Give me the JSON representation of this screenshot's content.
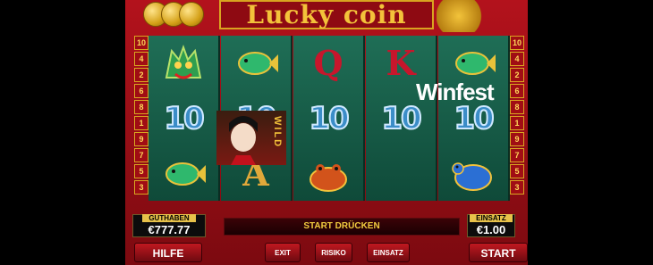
{
  "title": "Lucky coin",
  "watermark": "Winfest",
  "paylines": {
    "left": [
      "10",
      "4",
      "2",
      "6",
      "8",
      "1",
      "9",
      "7",
      "5",
      "3"
    ],
    "right": [
      "10",
      "4",
      "2",
      "6",
      "8",
      "1",
      "9",
      "7",
      "5",
      "3"
    ]
  },
  "reels": [
    [
      "dragon",
      "10",
      "fish"
    ],
    [
      "fish",
      "10",
      "A"
    ],
    [
      "Q",
      "10",
      "toad"
    ],
    [
      "K",
      "10",
      "wild"
    ],
    [
      "fish",
      "10",
      "turtle"
    ]
  ],
  "wild_label": "WILD",
  "balance": {
    "label": "GUTHABEN",
    "value": "€777.77"
  },
  "bet": {
    "label": "EINSATZ",
    "value": "€1.00"
  },
  "message": "START DRÜCKEN",
  "buttons": {
    "help": "HILFE",
    "exit": "EXIT",
    "risk": "RISIKO",
    "stake": "EINSATZ",
    "start": "START"
  }
}
